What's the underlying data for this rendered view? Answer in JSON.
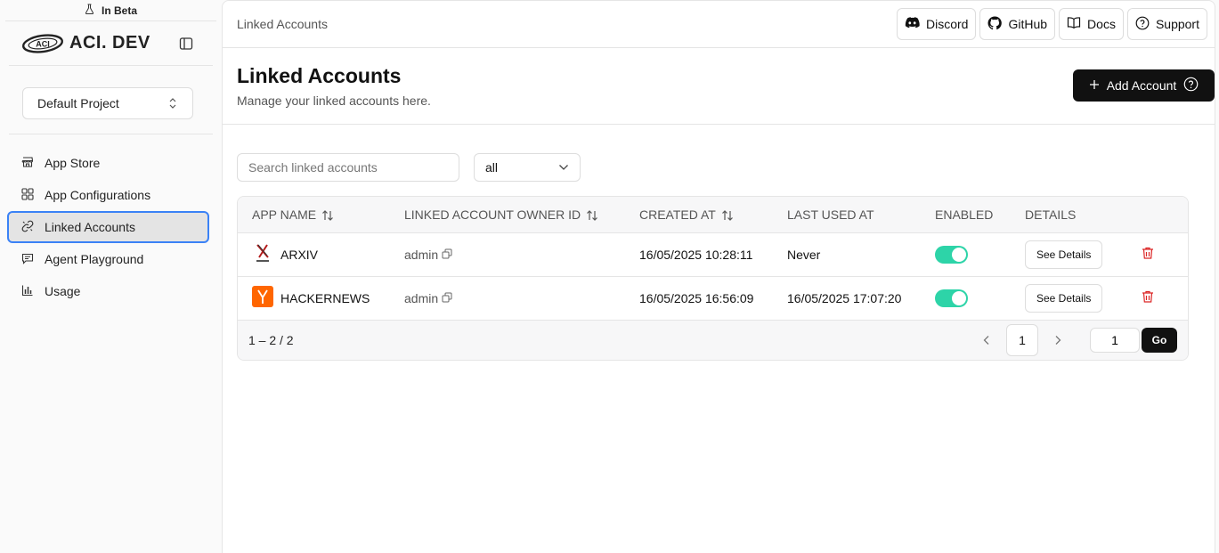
{
  "sidebar": {
    "beta_label": "In Beta",
    "brand_name": "ACI. DEV",
    "logo_text": "ACI",
    "project_label": "Default Project",
    "items": [
      {
        "label": "App Store",
        "icon": "store-icon"
      },
      {
        "label": "App Configurations",
        "icon": "grid-icon"
      },
      {
        "label": "Linked Accounts",
        "icon": "link-icon",
        "active": true
      },
      {
        "label": "Agent Playground",
        "icon": "chat-icon"
      },
      {
        "label": "Usage",
        "icon": "bar-chart-icon"
      }
    ]
  },
  "header": {
    "breadcrumb": "Linked Accounts",
    "buttons": [
      {
        "label": "Discord",
        "icon": "discord-icon"
      },
      {
        "label": "GitHub",
        "icon": "github-icon"
      },
      {
        "label": "Docs",
        "icon": "book-icon"
      },
      {
        "label": "Support",
        "icon": "help-circle-icon"
      }
    ]
  },
  "page": {
    "title": "Linked Accounts",
    "subtitle": "Manage your linked accounts here.",
    "add_button": "Add Account"
  },
  "filters": {
    "search_placeholder": "Search linked accounts",
    "select_value": "all"
  },
  "table": {
    "columns": [
      "APP NAME",
      "LINKED ACCOUNT OWNER ID",
      "CREATED AT",
      "LAST USED AT",
      "ENABLED",
      "DETAILS"
    ],
    "details_label": "See Details",
    "rows": [
      {
        "app": "ARXIV",
        "owner": "admin",
        "created": "16/05/2025 10:28:11",
        "last_used": "Never",
        "enabled": true
      },
      {
        "app": "HACKERNEWS",
        "owner": "admin",
        "created": "16/05/2025 16:56:09",
        "last_used": "16/05/2025 17:07:20",
        "enabled": true
      }
    ]
  },
  "pagination": {
    "summary": "1 – 2 / 2",
    "current_page": "1",
    "goto_value": "1",
    "go_label": "Go"
  },
  "colors": {
    "accent": "#111111",
    "toggle_on": "#2dd4a8",
    "delete": "#dc2626",
    "active_outline": "#3b82f6",
    "hackernews": "#ff6600"
  }
}
